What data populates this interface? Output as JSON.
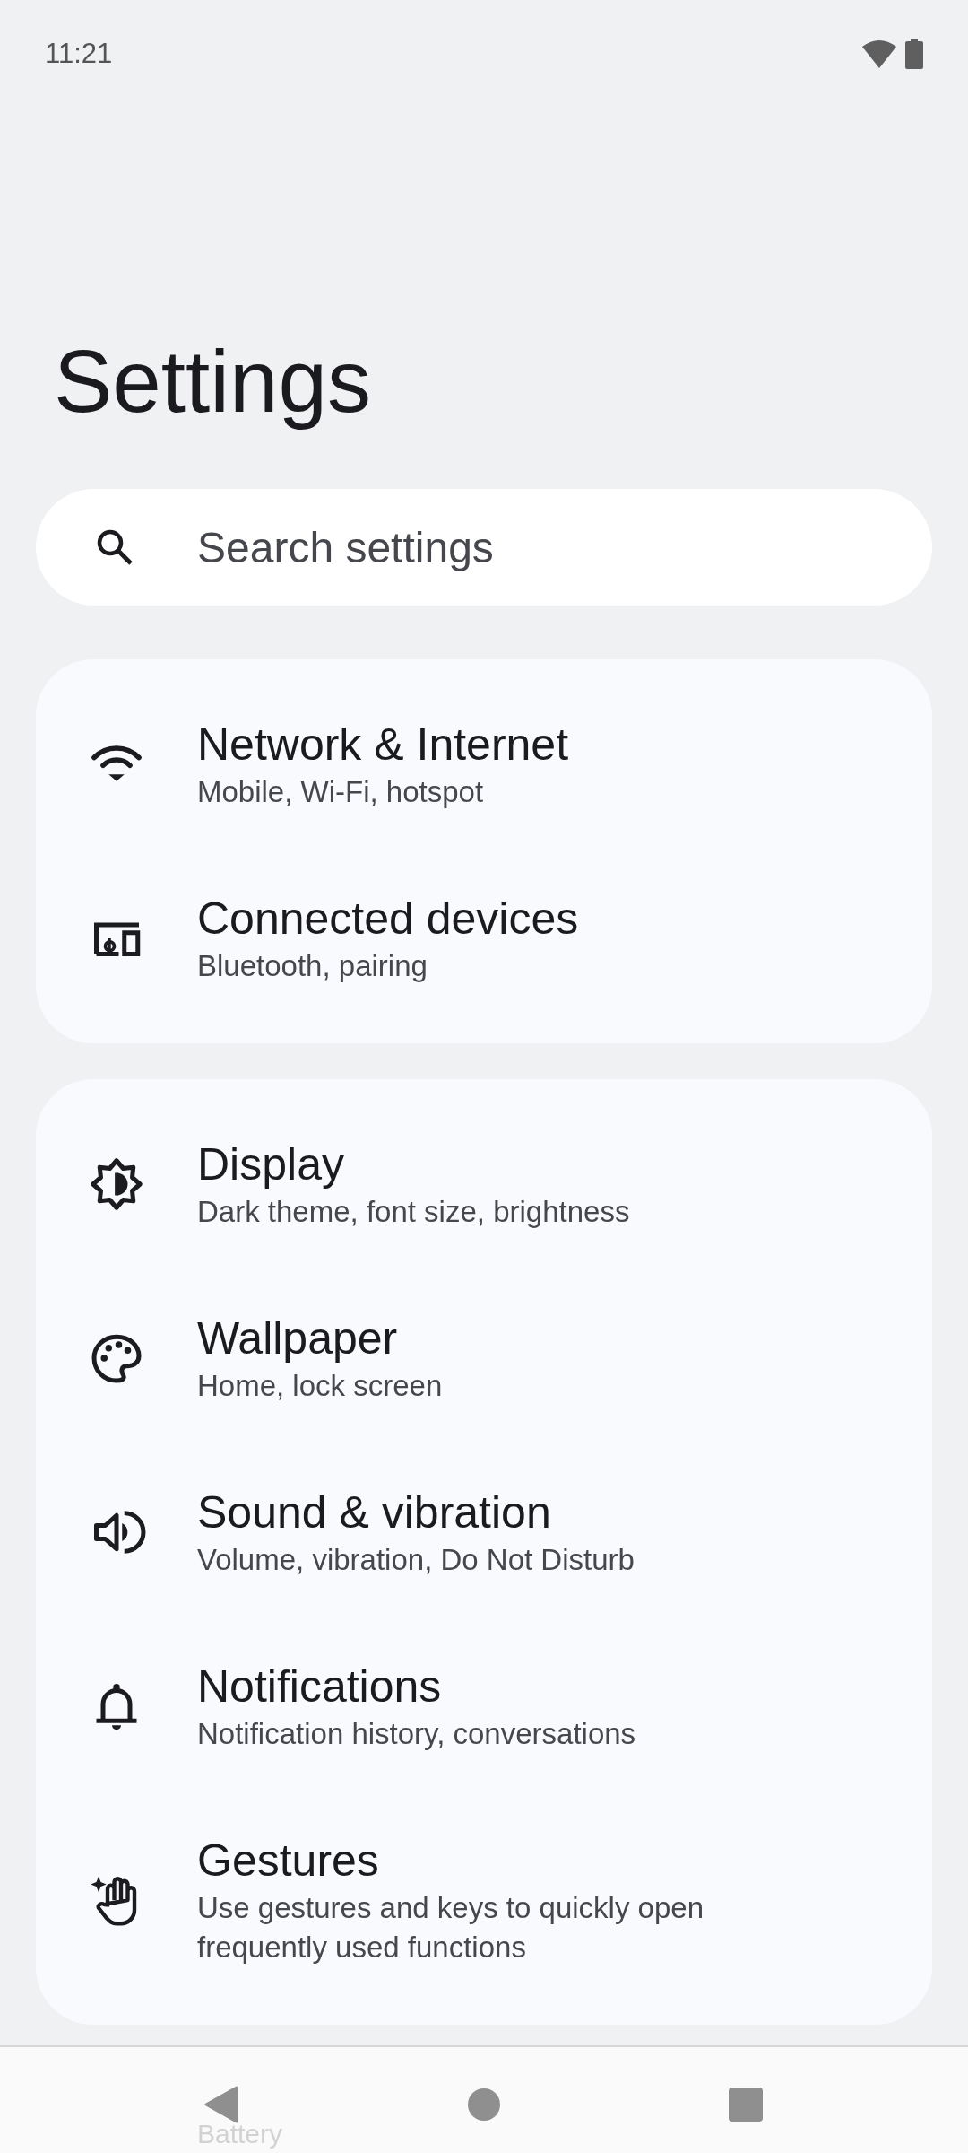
{
  "status_bar": {
    "time": "11:21"
  },
  "title": "Settings",
  "search": {
    "placeholder": "Search settings"
  },
  "groups": [
    {
      "items": [
        {
          "title": "Network & Internet",
          "summary": "Mobile, Wi-Fi, hotspot"
        },
        {
          "title": "Connected devices",
          "summary": "Bluetooth, pairing"
        }
      ]
    },
    {
      "items": [
        {
          "title": "Display",
          "summary": "Dark theme, font size, brightness"
        },
        {
          "title": "Wallpaper",
          "summary": "Home, lock screen"
        },
        {
          "title": "Sound & vibration",
          "summary": "Volume, vibration, Do Not Disturb"
        },
        {
          "title": "Notifications",
          "summary": "Notification history, conversations"
        },
        {
          "title": "Gestures",
          "summary": "Use gestures and keys to quickly open frequently used functions"
        }
      ]
    }
  ],
  "peek_item": {
    "title": "Battery"
  }
}
